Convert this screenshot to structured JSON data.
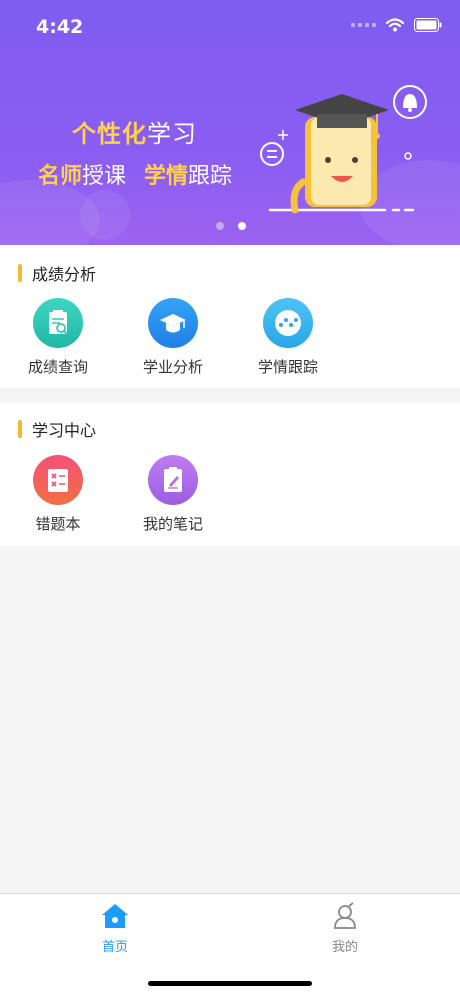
{
  "status": {
    "time": "4:42"
  },
  "banner": {
    "line1": {
      "hl": "个性化",
      "rest": "学习"
    },
    "line2": {
      "hl1": "名师",
      "rest1": "授课",
      "hl2": "学情",
      "rest2": "跟踪"
    },
    "carousel": {
      "count": 2,
      "active_index": 1
    }
  },
  "sections": [
    {
      "title": "成绩分析",
      "items": [
        {
          "label": "成绩查询",
          "icon": "report-search-icon",
          "color": "#2fc8b4"
        },
        {
          "label": "学业分析",
          "icon": "graduation-cap-icon",
          "color": "#2f8ff0"
        },
        {
          "label": "学情跟踪",
          "icon": "trend-dots-icon",
          "color": "#39b4ee"
        }
      ]
    },
    {
      "title": "学习中心",
      "items": [
        {
          "label": "错题本",
          "icon": "wrong-questions-icon",
          "color": "#f0506e"
        },
        {
          "label": "我的笔记",
          "icon": "notes-icon",
          "color": "#b46ee6"
        }
      ]
    }
  ],
  "tabbar": {
    "home": {
      "label": "首页",
      "active": true,
      "color": "#1e9bff"
    },
    "mine": {
      "label": "我的",
      "active": false,
      "color": "#888888"
    }
  },
  "colors": {
    "accent_yellow": "#ffd24a",
    "section_bar": "#f5b731",
    "banner_purple": "#8a5df2"
  }
}
